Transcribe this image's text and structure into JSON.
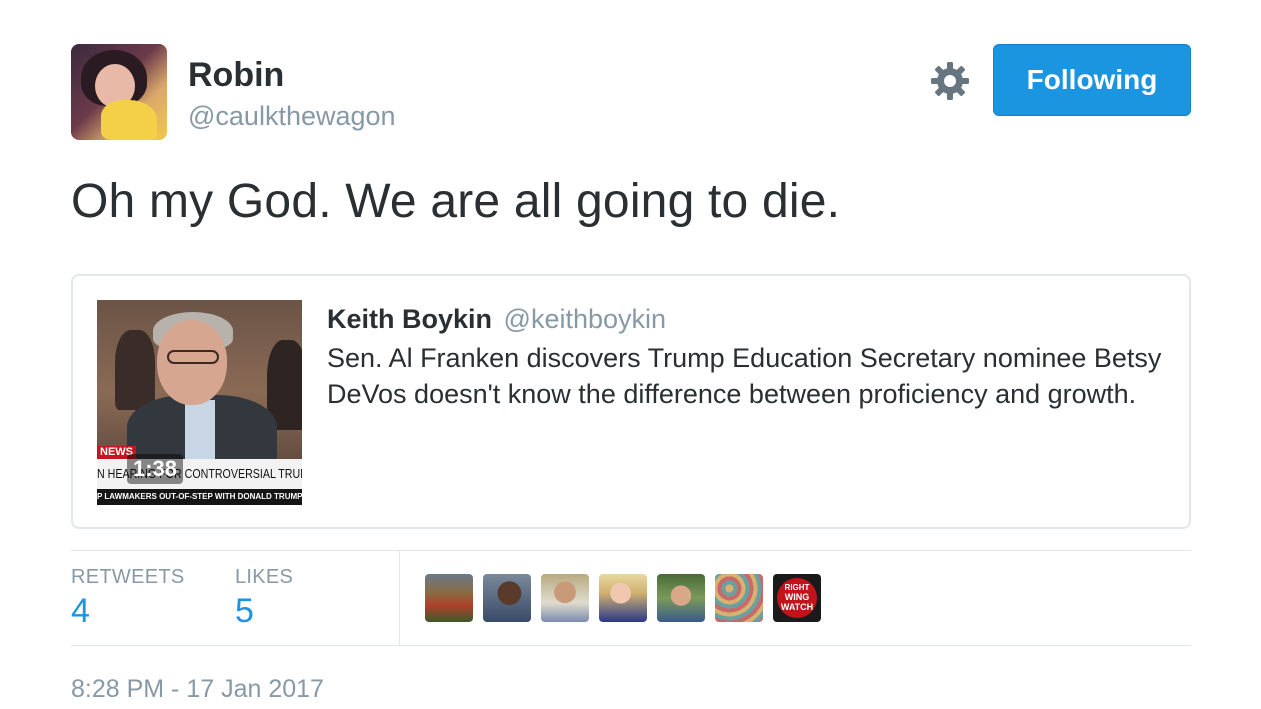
{
  "author": {
    "name": "Robin",
    "handle": "@caulkthewagon"
  },
  "actions": {
    "follow_label": "Following"
  },
  "tweet": {
    "text": "Oh my God. We are all going to die."
  },
  "quoted": {
    "name": "Keith Boykin",
    "handle": "@keithboykin",
    "text": "Sen. Al Franken discovers Trump Education Secretary nominee Betsy DeVos doesn't know the difference between proficiency and growth.",
    "video": {
      "duration": "1:38",
      "news_tag": "NEWS",
      "lower_third": "N HEARING FOR CONTROVERSIAL TRUMP NO",
      "ticker": "P LAWMAKERS OUT-OF-STEP WITH DONALD TRUMP"
    }
  },
  "stats": {
    "retweets_label": "RETWEETS",
    "retweets_value": "4",
    "likes_label": "LIKES",
    "likes_value": "5"
  },
  "likers": [
    {
      "id": "liker-1"
    },
    {
      "id": "liker-2"
    },
    {
      "id": "liker-3"
    },
    {
      "id": "liker-4"
    },
    {
      "id": "liker-5"
    },
    {
      "id": "liker-6"
    },
    {
      "id": "liker-7",
      "text_lines": [
        "RIGHT",
        "WING",
        "WATCH"
      ]
    }
  ],
  "timestamp": "8:28 PM - 17 Jan 2017",
  "colors": {
    "accent": "#1b95e0",
    "muted": "#8899a6",
    "text": "#292f33",
    "border": "#e1e8ed"
  }
}
